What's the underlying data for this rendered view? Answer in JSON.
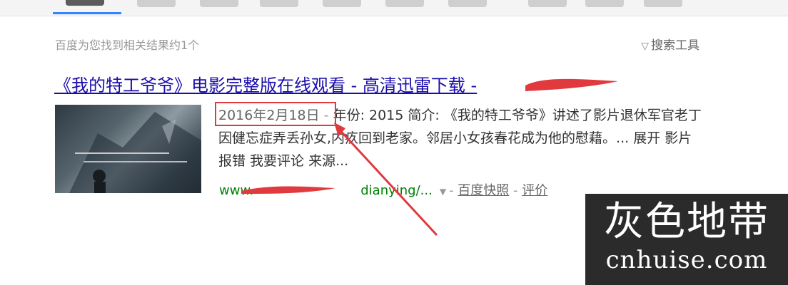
{
  "stats": {
    "text": "百度为您找到相关结果约1个"
  },
  "tools": {
    "label": "搜索工具",
    "icon": "filter-triangle-icon"
  },
  "result": {
    "title": "《我的特工爷爷》电影完整版在线观看 - 高清迅雷下载 - ",
    "title_domain": "",
    "date": "2016年2月18日",
    "sep": " - ",
    "intro": "年份: 2015 简介: 《我的特工爷爷》讲述了影片退休军官老丁因健忘症弄丢孙女,内疚回到老家。邻居小女孩春花成为他的慰藉。... ",
    "links_text": "展开 影片报错 我要评论 来源...",
    "url": "www.",
    "url_tail": "dianying/...",
    "snapshot_label": "百度快照",
    "rating_label": "评价",
    "url_sep": "-"
  },
  "colors": {
    "link": "#1a0dab",
    "url": "#008000",
    "annotation": "#e0393e"
  },
  "watermark": {
    "cn": "灰色地带",
    "en": "cnhuise.com"
  }
}
